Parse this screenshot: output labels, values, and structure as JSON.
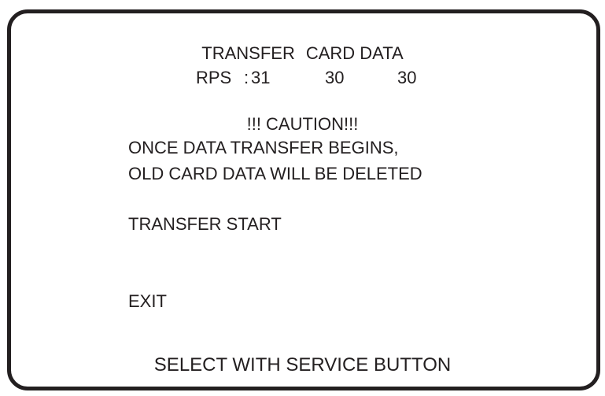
{
  "screen": {
    "title_part1": "TRANSFER",
    "title_part2": "CARD DATA",
    "rps": {
      "label": "RPS",
      "separator": ":",
      "values": [
        "31",
        "30",
        "30"
      ]
    },
    "caution": "!!! CAUTION!!!",
    "warning_lines": [
      "ONCE DATA TRANSFER BEGINS,",
      "OLD CARD DATA WILL BE DELETED"
    ],
    "menu": {
      "transfer_start": "TRANSFER START",
      "exit": "EXIT"
    },
    "footer": "SELECT WITH SERVICE BUTTON"
  }
}
